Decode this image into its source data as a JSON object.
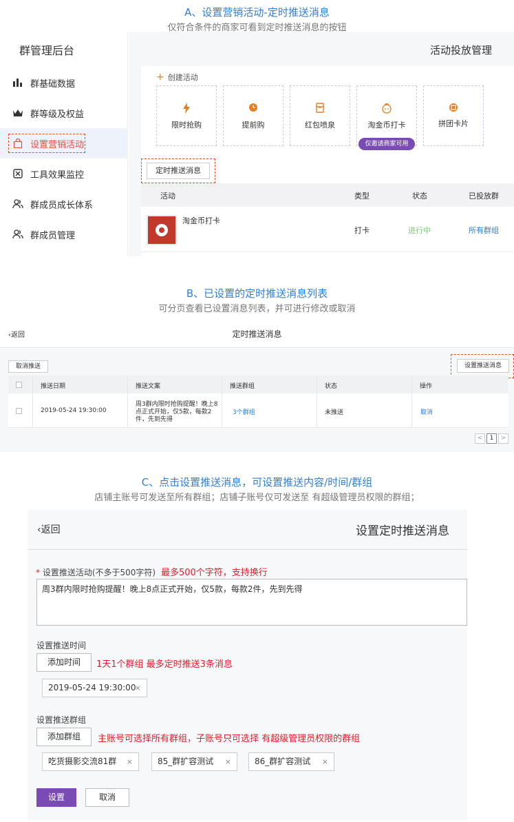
{
  "sectionA": {
    "title": "A、设置营销活动-定时推送消息",
    "subtitle": "仅符合条件的商家可看到定时推送消息的按钮",
    "sidebar": {
      "title": "群管理后台",
      "items": [
        {
          "label": "群基础数据",
          "icon": "bar-chart-icon"
        },
        {
          "label": "群等级及权益",
          "icon": "crown-icon"
        },
        {
          "label": "设置营销活动",
          "icon": "shopping-bag-icon"
        },
        {
          "label": "工具效果监控",
          "icon": "monitor-icon"
        },
        {
          "label": "群成员成长体系",
          "icon": "users-icon"
        },
        {
          "label": "群成员管理",
          "icon": "users-icon"
        }
      ]
    },
    "page_title": "活动投放管理",
    "create_label": "创建活动",
    "cards": [
      {
        "label": "限时抢购",
        "icon": "lightning-icon"
      },
      {
        "label": "提前购",
        "icon": "clock-icon"
      },
      {
        "label": "红包喷泉",
        "icon": "red-packet-icon"
      },
      {
        "label": "淘金币打卡",
        "icon": "coin-icon"
      },
      {
        "label": "拼团卡片",
        "icon": "group-icon"
      }
    ],
    "invite_pill": "仅邀请商家可用",
    "schedule_button": "定时推送消息",
    "table": {
      "headers": [
        "活动",
        "类型",
        "状态",
        "已投放群"
      ],
      "row": {
        "name": "淘金币打卡",
        "type": "打卡",
        "status": "进行中",
        "groups": "所有群组"
      }
    },
    "colors": {
      "accent_red": "#e34b2e",
      "status_green": "#7bc67b",
      "link_blue": "#2f7fd8",
      "pill_purple": "#7b4bb5"
    }
  },
  "sectionB": {
    "title": "B、已设置的定时推送消息列表",
    "subtitle": "可分页查看已设置消息列表，并可进行修改或取消",
    "back_label": "返回",
    "page_title": "定时推送消息",
    "cancel_push_button": "取消推送",
    "set_push_button": "设置推送消息",
    "table": {
      "headers": [
        "推送日期",
        "推送文案",
        "推送群组",
        "状态",
        "操作"
      ],
      "row": {
        "date": "2019-05-24 19:30:00",
        "copy_line1": "周3群内限时抢购提醒！晚上8",
        "copy_line2": "点正式开始，仅5款，每款2",
        "copy_line3": "件，先到先得",
        "groups": "3个群组",
        "status": "未推送",
        "action": "取消"
      }
    },
    "pager": {
      "prev": "<",
      "page": "1",
      "next": ">"
    }
  },
  "sectionC": {
    "title": "C、点击设置推送消息，可设置推送内容/时间/群组",
    "subtitle": "店铺主账号可发送至所有群组；店铺子账号仅可发送至 有超级管理员权限的群组；",
    "back_label": "返回",
    "page_title": "设置定时推送消息",
    "content_label": "设置推送活动(不多于500字符)",
    "content_required": "*",
    "content_note": "最多500个字符，支持换行",
    "content_value": "周3群内限时抢购提醒！晚上8点正式开始，仅5款，每款2件，先到先得",
    "time_label": "设置推送时间",
    "add_time_button": "添加时间",
    "time_note": "1天1个群组 最多定时推送3条消息",
    "time_tags": [
      "2019-05-24 19:30:00"
    ],
    "group_label": "设置推送群组",
    "add_group_button": "添加群组",
    "group_note": "主账号可选择所有群组，子账号只可选择 有超级管理员权限的群组",
    "group_tags": [
      "吃货摄影交流81群",
      "85_群扩容测试",
      "86_群扩容测试"
    ],
    "remove_glyph": "×",
    "submit_button": "设置",
    "cancel_button": "取消",
    "colors": {
      "primary_purple": "#7b4bb5",
      "note_red": "#e0202c"
    }
  }
}
